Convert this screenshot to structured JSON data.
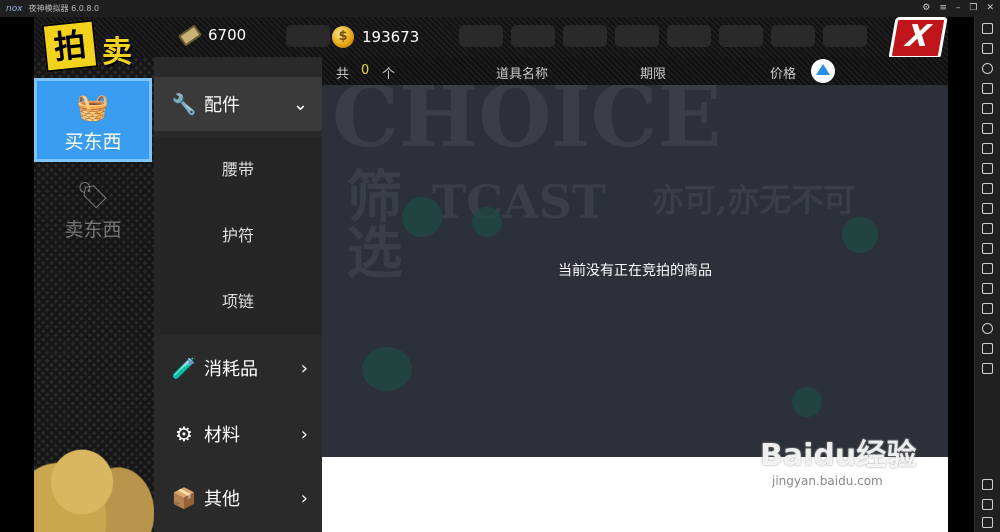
{
  "window": {
    "logo": "nox",
    "title": "夜神模拟器 6.0.8.0"
  },
  "title_art": {
    "char1": "拍",
    "char2": "卖"
  },
  "currency": {
    "tickets": "6700",
    "coins": "193673"
  },
  "close_label": "X",
  "modes": {
    "buy": "买东西",
    "sell": "卖东西"
  },
  "categories": [
    {
      "label": "配件",
      "icon": "accessory-icon",
      "expanded": true
    },
    {
      "label": "消耗品",
      "icon": "potion-icon",
      "expanded": false
    },
    {
      "label": "材料",
      "icon": "gear-icon",
      "expanded": false
    },
    {
      "label": "其他",
      "icon": "box-icon",
      "expanded": false
    }
  ],
  "subcategories": [
    "腰带",
    "护符",
    "项链"
  ],
  "header": {
    "total_prefix": "共",
    "total_count": "0",
    "total_suffix": "个",
    "col_name": "道具名称",
    "col_term": "期限",
    "col_price": "价格"
  },
  "background_text": {
    "large": "CHOICE",
    "left": "筛选",
    "mid": "TCAST",
    "right": "亦可,亦无不可"
  },
  "empty_message": "当前没有正在竞拍的商品",
  "watermark": {
    "line1": "Baidu经验",
    "line2": "jingyan.baidu.com"
  }
}
